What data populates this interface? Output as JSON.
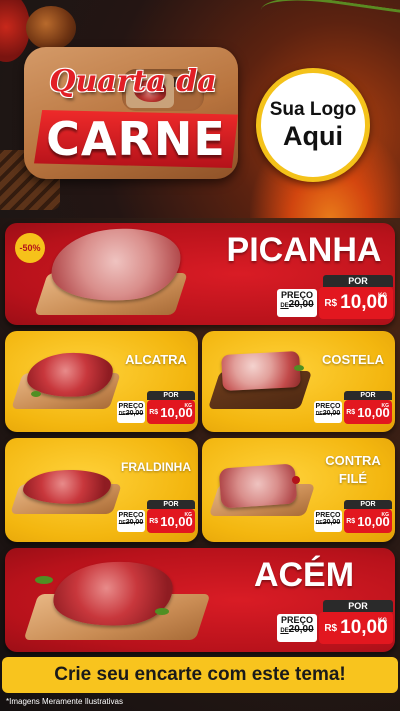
{
  "header": {
    "title_script": "Quarta da",
    "title_main": "CARNE",
    "logo_line1": "Sua Logo",
    "logo_line2": "Aqui"
  },
  "featured_1": {
    "badge": "-50%",
    "name": "PICANHA",
    "por": "POR",
    "preco": "PREÇO",
    "de": "DE",
    "old_price": "20,00",
    "currency": "R$",
    "price": "10,00",
    "unit": "KG"
  },
  "grid": [
    {
      "name": "ALCATRA",
      "por": "POR",
      "preco": "PREÇO",
      "de": "DE",
      "old_price": "20,00",
      "currency": "R$",
      "price": "10,00",
      "unit": "KG"
    },
    {
      "name": "COSTELA",
      "por": "POR",
      "preco": "PREÇO",
      "de": "DE",
      "old_price": "20,00",
      "currency": "R$",
      "price": "10,00",
      "unit": "KG"
    },
    {
      "name": "FRALDINHA",
      "por": "POR",
      "preco": "PREÇO",
      "de": "DE",
      "old_price": "20,00",
      "currency": "R$",
      "price": "10,00",
      "unit": "KG"
    },
    {
      "name_line1": "CONTRA",
      "name_line2": "FILÉ",
      "por": "POR",
      "preco": "PREÇO",
      "de": "DE",
      "old_price": "20,00",
      "currency": "R$",
      "price": "10,00",
      "unit": "KG"
    }
  ],
  "featured_2": {
    "name": "ACÉM",
    "por": "POR",
    "preco": "PREÇO",
    "de": "DE",
    "old_price": "20,00",
    "currency": "R$",
    "price": "10,00",
    "unit": "KG"
  },
  "footer": {
    "cta": "Crie seu encarte com este tema!",
    "disclaimer": "*Imagens Meramente Ilustrativas"
  },
  "colors": {
    "red": "#d91c25",
    "yellow": "#f3b60f",
    "price_red": "#e2171f",
    "dark": "#2a2a2a"
  },
  "icons": [
    "steak-icon",
    "meat-cut-image",
    "herb-garnish"
  ]
}
